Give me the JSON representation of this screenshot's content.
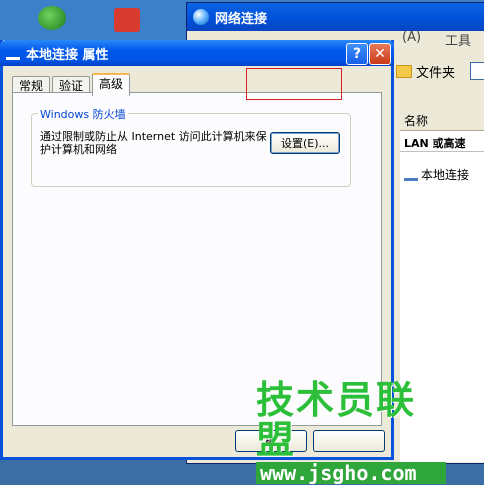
{
  "background_window": {
    "title": "网络连接",
    "menu": [
      "(A)",
      "工具"
    ],
    "toolbar_folder": "文件夹",
    "list_header": "名称",
    "group_label": "LAN 或高速",
    "item_label": "本地连接"
  },
  "dialog": {
    "title": "本地连接 属性",
    "help_label": "?",
    "close_label": "✕",
    "tabs": [
      {
        "label": "常规",
        "active": false
      },
      {
        "label": "验证",
        "active": false
      },
      {
        "label": "高级",
        "active": true
      }
    ],
    "firewall": {
      "legend": "Windows 防火墙",
      "description": "通过限制或防止从 Internet 访问此计算机来保护计算机和网络",
      "settings_button": "设置(E)..."
    },
    "ok_label": "确",
    "cancel_label": ""
  },
  "watermark": {
    "title": "技术员联盟",
    "url": "www.jsgho.com"
  },
  "colors": {
    "title_bar": "#0054e3",
    "highlight": "#d32020",
    "watermark_green": "#2cbf3a"
  }
}
